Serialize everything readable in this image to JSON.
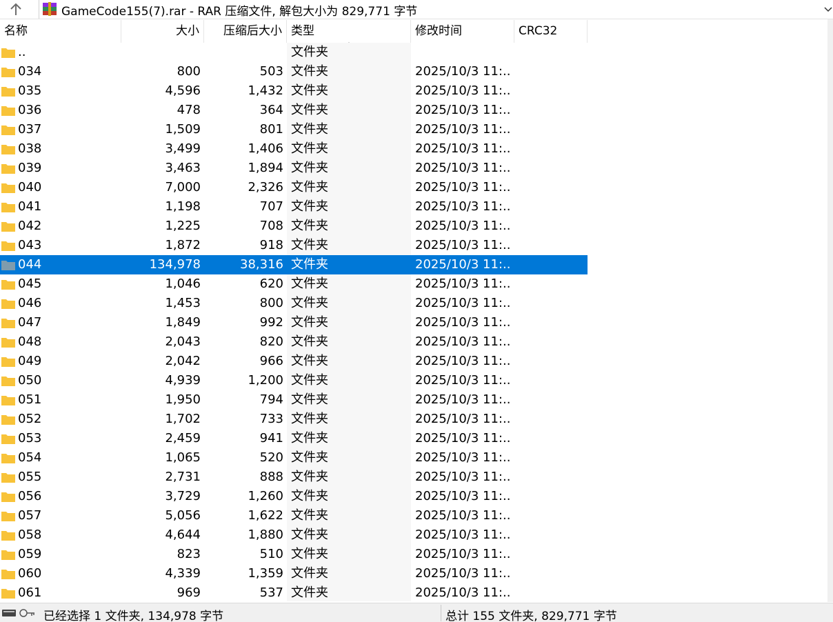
{
  "title": "GameCode155(7).rar - RAR 压缩文件, 解包大小为 829,771 字节",
  "icons": {
    "up": "arrow-up-icon",
    "archive": "rar-archive-icon",
    "folder": "folder-icon",
    "dropdown": "chevron-down-icon",
    "sort": "sort-ascending-icon"
  },
  "columns": {
    "name": "名称",
    "size": "大小",
    "packed": "压缩后大小",
    "type": "类型",
    "modified": "修改时间",
    "crc": "CRC32"
  },
  "rows": [
    {
      "name": "..",
      "size": "",
      "packed": "",
      "type": "文件夹",
      "modified": ""
    },
    {
      "name": "034",
      "size": "800",
      "packed": "503",
      "type": "文件夹",
      "modified": "2025/10/3 11:..."
    },
    {
      "name": "035",
      "size": "4,596",
      "packed": "1,432",
      "type": "文件夹",
      "modified": "2025/10/3 11:..."
    },
    {
      "name": "036",
      "size": "478",
      "packed": "364",
      "type": "文件夹",
      "modified": "2025/10/3 11:..."
    },
    {
      "name": "037",
      "size": "1,509",
      "packed": "801",
      "type": "文件夹",
      "modified": "2025/10/3 11:..."
    },
    {
      "name": "038",
      "size": "3,499",
      "packed": "1,406",
      "type": "文件夹",
      "modified": "2025/10/3 11:..."
    },
    {
      "name": "039",
      "size": "3,463",
      "packed": "1,894",
      "type": "文件夹",
      "modified": "2025/10/3 11:..."
    },
    {
      "name": "040",
      "size": "7,000",
      "packed": "2,326",
      "type": "文件夹",
      "modified": "2025/10/3 11:..."
    },
    {
      "name": "041",
      "size": "1,198",
      "packed": "707",
      "type": "文件夹",
      "modified": "2025/10/3 11:..."
    },
    {
      "name": "042",
      "size": "1,225",
      "packed": "708",
      "type": "文件夹",
      "modified": "2025/10/3 11:..."
    },
    {
      "name": "043",
      "size": "1,872",
      "packed": "918",
      "type": "文件夹",
      "modified": "2025/10/3 11:..."
    },
    {
      "name": "044",
      "size": "134,978",
      "packed": "38,316",
      "type": "文件夹",
      "modified": "2025/10/3 11:...",
      "selected": true
    },
    {
      "name": "045",
      "size": "1,046",
      "packed": "620",
      "type": "文件夹",
      "modified": "2025/10/3 11:..."
    },
    {
      "name": "046",
      "size": "1,453",
      "packed": "800",
      "type": "文件夹",
      "modified": "2025/10/3 11:..."
    },
    {
      "name": "047",
      "size": "1,849",
      "packed": "992",
      "type": "文件夹",
      "modified": "2025/10/3 11:..."
    },
    {
      "name": "048",
      "size": "2,043",
      "packed": "820",
      "type": "文件夹",
      "modified": "2025/10/3 11:..."
    },
    {
      "name": "049",
      "size": "2,042",
      "packed": "966",
      "type": "文件夹",
      "modified": "2025/10/3 11:..."
    },
    {
      "name": "050",
      "size": "4,939",
      "packed": "1,200",
      "type": "文件夹",
      "modified": "2025/10/3 11:..."
    },
    {
      "name": "051",
      "size": "1,950",
      "packed": "794",
      "type": "文件夹",
      "modified": "2025/10/3 11:..."
    },
    {
      "name": "052",
      "size": "1,702",
      "packed": "733",
      "type": "文件夹",
      "modified": "2025/10/3 11:..."
    },
    {
      "name": "053",
      "size": "2,459",
      "packed": "941",
      "type": "文件夹",
      "modified": "2025/10/3 11:..."
    },
    {
      "name": "054",
      "size": "1,065",
      "packed": "520",
      "type": "文件夹",
      "modified": "2025/10/3 11:..."
    },
    {
      "name": "055",
      "size": "2,731",
      "packed": "888",
      "type": "文件夹",
      "modified": "2025/10/3 11:..."
    },
    {
      "name": "056",
      "size": "3,729",
      "packed": "1,260",
      "type": "文件夹",
      "modified": "2025/10/3 11:..."
    },
    {
      "name": "057",
      "size": "5,056",
      "packed": "1,622",
      "type": "文件夹",
      "modified": "2025/10/3 11:..."
    },
    {
      "name": "058",
      "size": "4,644",
      "packed": "1,880",
      "type": "文件夹",
      "modified": "2025/10/3 11:..."
    },
    {
      "name": "059",
      "size": "823",
      "packed": "510",
      "type": "文件夹",
      "modified": "2025/10/3 11:..."
    },
    {
      "name": "060",
      "size": "4,339",
      "packed": "1,359",
      "type": "文件夹",
      "modified": "2025/10/3 11:..."
    },
    {
      "name": "061",
      "size": "969",
      "packed": "537",
      "type": "文件夹",
      "modified": "2025/10/3 11:..."
    }
  ],
  "status": {
    "left": "已经选择 1 文件夹, 134,978 字节",
    "right": "总计 155 文件夹, 829,771 字节"
  },
  "colors": {
    "selection": "#0078d7",
    "folder": "#f8c33a",
    "folder_selected": "#7f9cad"
  }
}
